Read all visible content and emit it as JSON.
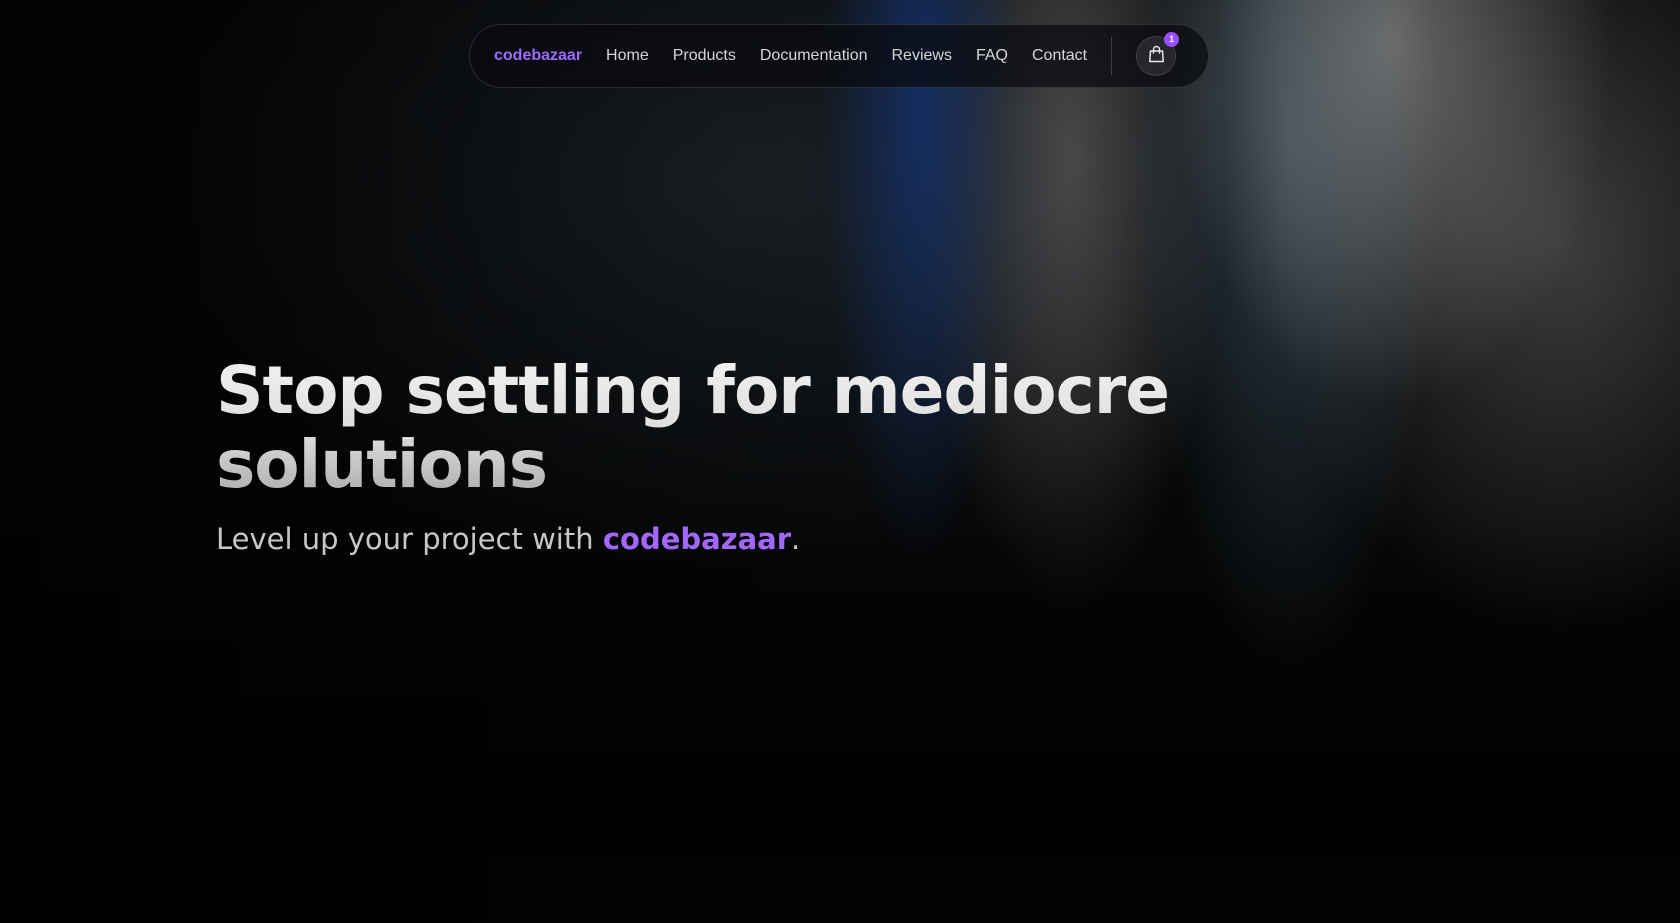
{
  "nav": {
    "brand": "codebazaar",
    "links": [
      "Home",
      "Products",
      "Documentation",
      "Reviews",
      "FAQ",
      "Contact"
    ],
    "cart_icon": "shopping-bag-icon",
    "cart_count": "1"
  },
  "hero": {
    "title": "Stop settling for mediocre solutions",
    "subtitle_prefix": "Level up your project with ",
    "subtitle_brand": "codebazaar",
    "subtitle_suffix": "."
  },
  "colors": {
    "accent": "#9b6bff",
    "badge": "#9b4dff"
  }
}
